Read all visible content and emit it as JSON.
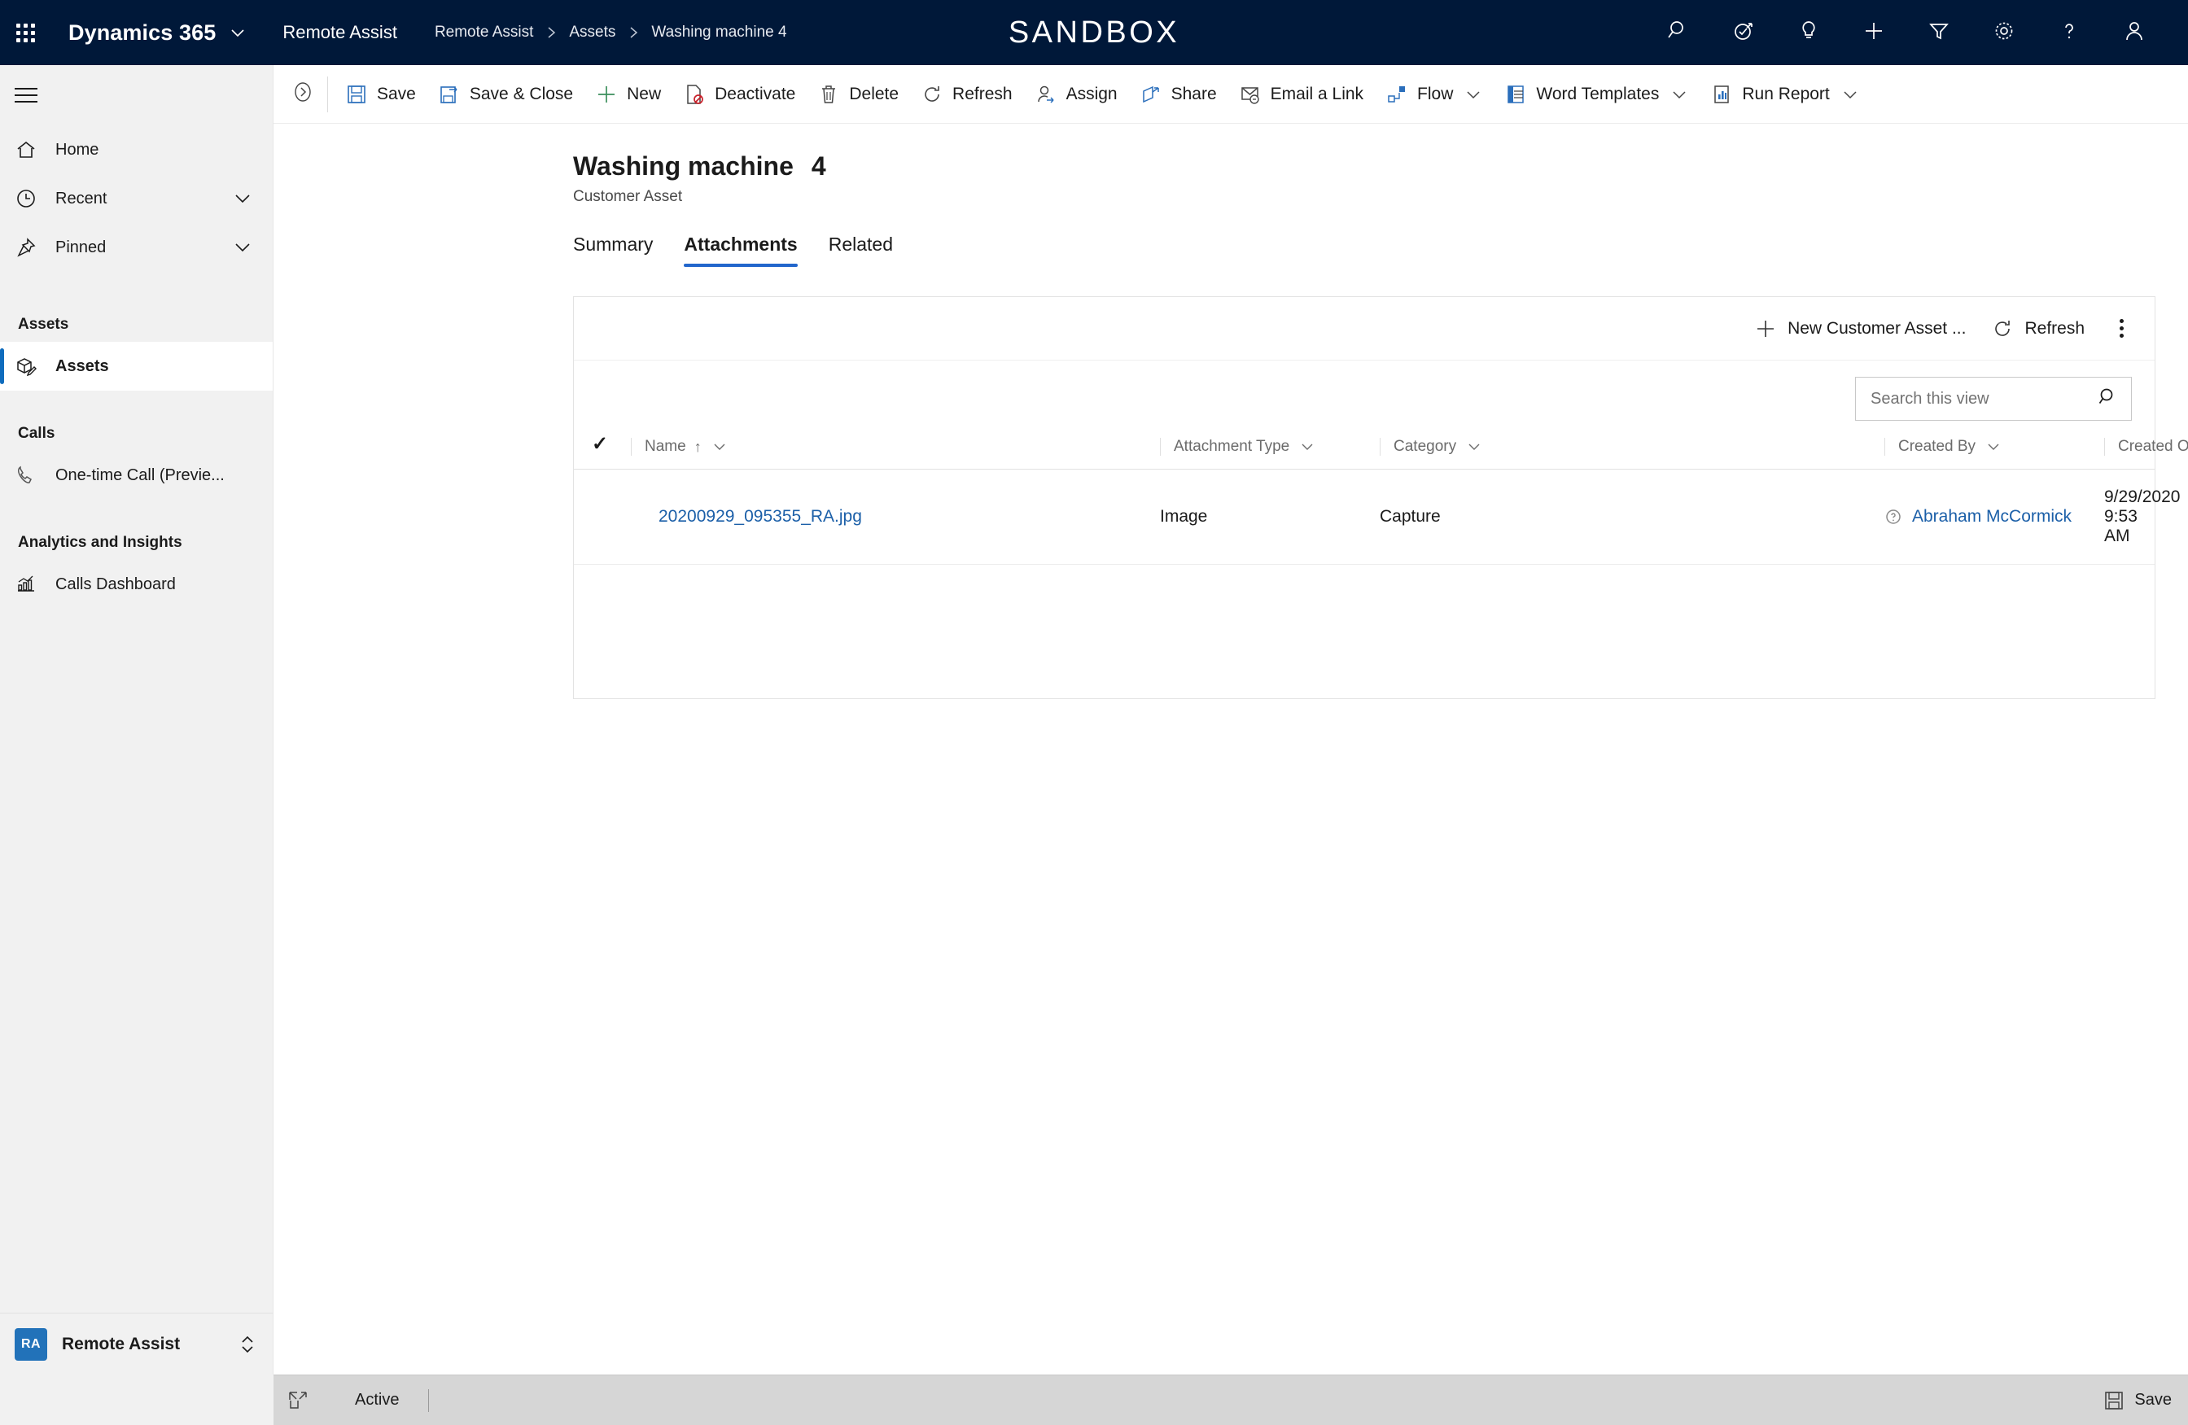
{
  "topbar": {
    "waffle_label": "app-launcher",
    "brand": "Dynamics 365",
    "app_name": "Remote Assist",
    "environment_banner": "SANDBOX",
    "breadcrumb": [
      {
        "label": "Remote Assist"
      },
      {
        "label": "Assets"
      },
      {
        "label": "Washing machine 4"
      }
    ],
    "actions": [
      {
        "name": "search-icon",
        "title": "Search"
      },
      {
        "name": "assistant-icon",
        "title": "Assistant"
      },
      {
        "name": "lightbulb-icon",
        "title": "Ideas"
      },
      {
        "name": "add-icon",
        "title": "Quick create"
      },
      {
        "name": "filter-icon",
        "title": "Filter"
      },
      {
        "name": "gear-icon",
        "title": "Settings"
      },
      {
        "name": "help-icon",
        "title": "Help"
      },
      {
        "name": "person-icon",
        "title": "Account manager"
      }
    ]
  },
  "sidebar": {
    "nav": [
      {
        "label": "Home",
        "icon": "home-icon",
        "chevron": false,
        "selected": false
      },
      {
        "label": "Recent",
        "icon": "clock-icon",
        "chevron": true,
        "selected": false
      },
      {
        "label": "Pinned",
        "icon": "pin-icon",
        "chevron": true,
        "selected": false
      }
    ],
    "groups": [
      {
        "title": "Assets",
        "items": [
          {
            "label": "Assets",
            "icon": "asset-box-icon",
            "selected": true
          }
        ]
      },
      {
        "title": "Calls",
        "items": [
          {
            "label": "One-time Call (Previe...",
            "icon": "phone-icon",
            "selected": false
          }
        ]
      },
      {
        "title": "Analytics and Insights",
        "items": [
          {
            "label": "Calls Dashboard",
            "icon": "chart-icon",
            "selected": false
          }
        ]
      }
    ],
    "footer": {
      "badge": "RA",
      "label": "Remote Assist"
    }
  },
  "commandbar": {
    "collapse_title": "Expand command bar",
    "buttons": [
      {
        "label": "Save",
        "icon": "save-icon",
        "dropdown": false
      },
      {
        "label": "Save & Close",
        "icon": "save-close-icon",
        "dropdown": false
      },
      {
        "label": "New",
        "icon": "plus-icon",
        "dropdown": false
      },
      {
        "label": "Deactivate",
        "icon": "deactivate-icon",
        "dropdown": false
      },
      {
        "label": "Delete",
        "icon": "trash-icon",
        "dropdown": false
      },
      {
        "label": "Refresh",
        "icon": "refresh-icon",
        "dropdown": false
      },
      {
        "label": "Assign",
        "icon": "assign-icon",
        "dropdown": false
      },
      {
        "label": "Share",
        "icon": "share-icon",
        "dropdown": false
      },
      {
        "label": "Email a Link",
        "icon": "email-link-icon",
        "dropdown": false
      },
      {
        "label": "Flow",
        "icon": "flow-icon",
        "dropdown": true
      },
      {
        "label": "Word Templates",
        "icon": "word-icon",
        "dropdown": true
      },
      {
        "label": "Run Report",
        "icon": "report-icon",
        "dropdown": true
      }
    ]
  },
  "page": {
    "title": "Washing machine",
    "record_number": "4",
    "subtitle": "Customer Asset",
    "tabs": [
      {
        "label": "Summary",
        "active": false
      },
      {
        "label": "Attachments",
        "active": true
      },
      {
        "label": "Related",
        "active": false
      }
    ]
  },
  "grid": {
    "toolbar": [
      {
        "label": "New Customer Asset ...",
        "icon": "plus-icon"
      },
      {
        "label": "Refresh",
        "icon": "refresh-icon"
      }
    ],
    "overflow_label": "More commands",
    "search": {
      "placeholder": "Search this view",
      "value": "",
      "icon": "search-icon"
    },
    "columns": [
      {
        "label": "Name",
        "sort": "asc",
        "chevron": true
      },
      {
        "label": "Attachment Type",
        "sort": "",
        "chevron": true
      },
      {
        "label": "Category",
        "sort": "",
        "chevron": true
      },
      {
        "label": "Created By",
        "sort": "",
        "chevron": true
      },
      {
        "label": "Created On",
        "sort": "",
        "chevron": true
      }
    ],
    "rows": [
      {
        "name": "20200929_095355_RA.jpg",
        "attachment_type": "Image",
        "category": "Capture",
        "created_by": "Abraham McCormick",
        "created_on": "9/29/2020 9:53 AM"
      }
    ]
  },
  "statusbar": {
    "popout_title": "Open in new window",
    "status": "Active",
    "save_label": "Save"
  },
  "colors": {
    "nav_bg": "#001839",
    "accent": "#0f6cbd",
    "link": "#1b5fa8",
    "tab_underline": "#2266cc",
    "sidebar_bg": "#f1f1f1",
    "statusbar_bg": "#d6d6d6",
    "badge_bg": "#2272b9"
  }
}
